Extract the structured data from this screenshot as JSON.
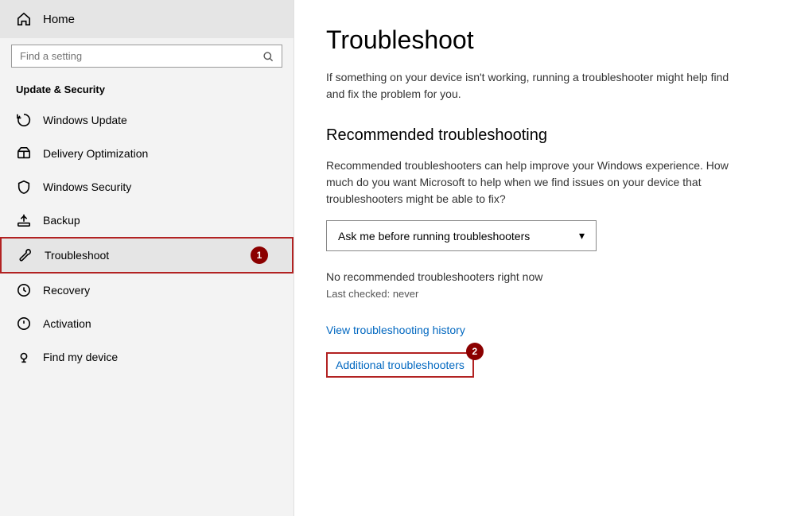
{
  "sidebar": {
    "home_label": "Home",
    "search_placeholder": "Find a setting",
    "section_title": "Update & Security",
    "items": [
      {
        "id": "windows-update",
        "label": "Windows Update",
        "icon": "update"
      },
      {
        "id": "delivery-optimization",
        "label": "Delivery Optimization",
        "icon": "delivery"
      },
      {
        "id": "windows-security",
        "label": "Windows Security",
        "icon": "shield"
      },
      {
        "id": "backup",
        "label": "Backup",
        "icon": "backup"
      },
      {
        "id": "troubleshoot",
        "label": "Troubleshoot",
        "icon": "wrench",
        "active": true,
        "badge": "1"
      },
      {
        "id": "recovery",
        "label": "Recovery",
        "icon": "recovery"
      },
      {
        "id": "activation",
        "label": "Activation",
        "icon": "activation"
      },
      {
        "id": "find-my-device",
        "label": "Find my device",
        "icon": "find"
      }
    ]
  },
  "main": {
    "page_title": "Troubleshoot",
    "page_description": "If something on your device isn't working, running a troubleshooter might help find and fix the problem for you.",
    "recommended_section_title": "Recommended troubleshooting",
    "recommended_description": "Recommended troubleshooters can help improve your Windows experience. How much do you want Microsoft to help when we find issues on your device that troubleshooters might be able to fix?",
    "dropdown_value": "Ask me before running troubleshooters",
    "dropdown_chevron": "▾",
    "no_troubleshooters_text": "No recommended troubleshooters right now",
    "last_checked_text": "Last checked: never",
    "view_history_link": "View troubleshooting history",
    "additional_link": "Additional troubleshooters",
    "additional_badge": "2"
  }
}
